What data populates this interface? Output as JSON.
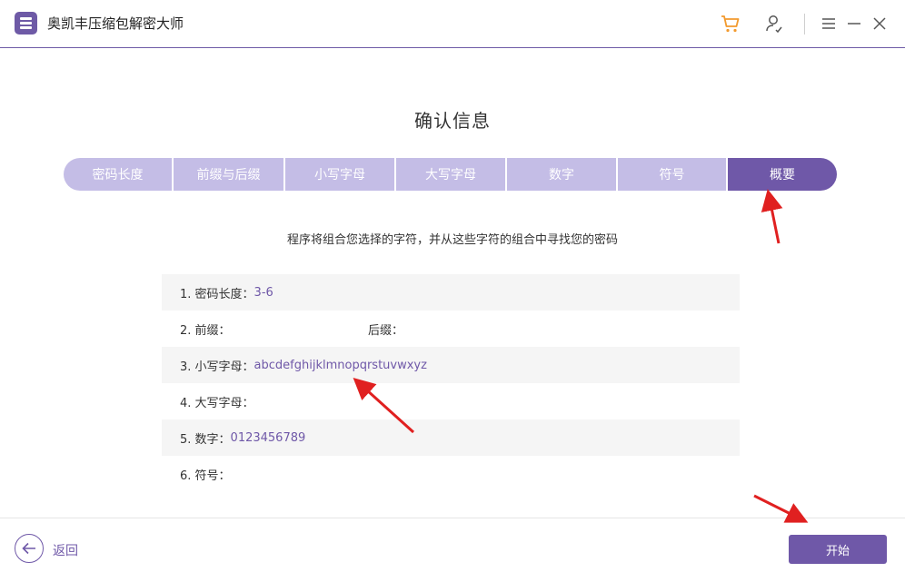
{
  "app": {
    "title": "奥凯丰压缩包解密大师"
  },
  "header": {
    "icons": [
      "cart-icon",
      "user-icon",
      "menu-icon",
      "minimize-icon",
      "close-icon"
    ]
  },
  "page": {
    "title": "确认信息",
    "description": "程序将组合您选择的字符，并从这些字符的组合中寻找您的密码"
  },
  "steps": [
    {
      "label": "密码长度"
    },
    {
      "label": "前缀与后缀"
    },
    {
      "label": "小写字母"
    },
    {
      "label": "大写字母"
    },
    {
      "label": "数字"
    },
    {
      "label": "符号"
    },
    {
      "label": "概要",
      "active": true
    }
  ],
  "summary": {
    "length_label": "1. 密码长度：",
    "length_value": "3-6",
    "prefix_label": "2. 前缀：",
    "suffix_label": "后缀：",
    "lower_label": "3. 小写字母：",
    "lower_value": "abcdefghijklmnopqrstuvwxyz",
    "upper_label": "4. 大写字母：",
    "digits_label": "5. 数字：",
    "digits_value": "0123456789",
    "symbols_label": "6. 符号："
  },
  "footer": {
    "back_label": "返回",
    "start_label": "开始"
  },
  "colors": {
    "accent": "#6f58a8",
    "step_inactive": "#c4bde6",
    "annotation": "#e02020",
    "cart": "#f29a2e"
  }
}
